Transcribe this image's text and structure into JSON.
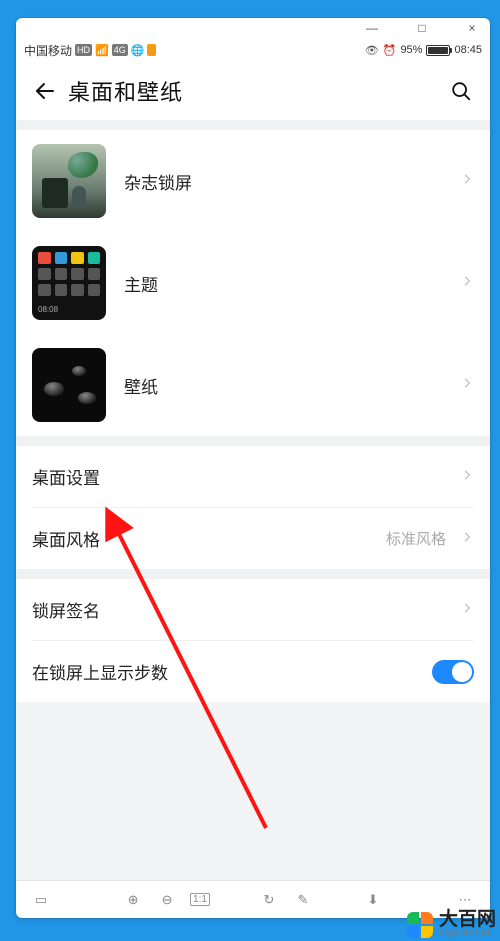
{
  "statusbar": {
    "carrier": "中国移动",
    "hd_badge": "HD",
    "net_badge": "4G",
    "battery_text": "95%",
    "battery_fill_percent": 95,
    "time": "08:45"
  },
  "header": {
    "title": "桌面和壁纸"
  },
  "section_thumbs": [
    {
      "label": "杂志锁屏"
    },
    {
      "label": "主题"
    },
    {
      "label": "壁纸"
    }
  ],
  "rows": {
    "home_settings": "桌面设置",
    "home_style_label": "桌面风格",
    "home_style_value": "标准风格",
    "lock_signature": "锁屏签名",
    "show_steps": "在锁屏上显示步数"
  },
  "emu_toolbar": {
    "scale_label": "1:1"
  },
  "watermark": {
    "name": "大百网",
    "url": "big100.net"
  }
}
